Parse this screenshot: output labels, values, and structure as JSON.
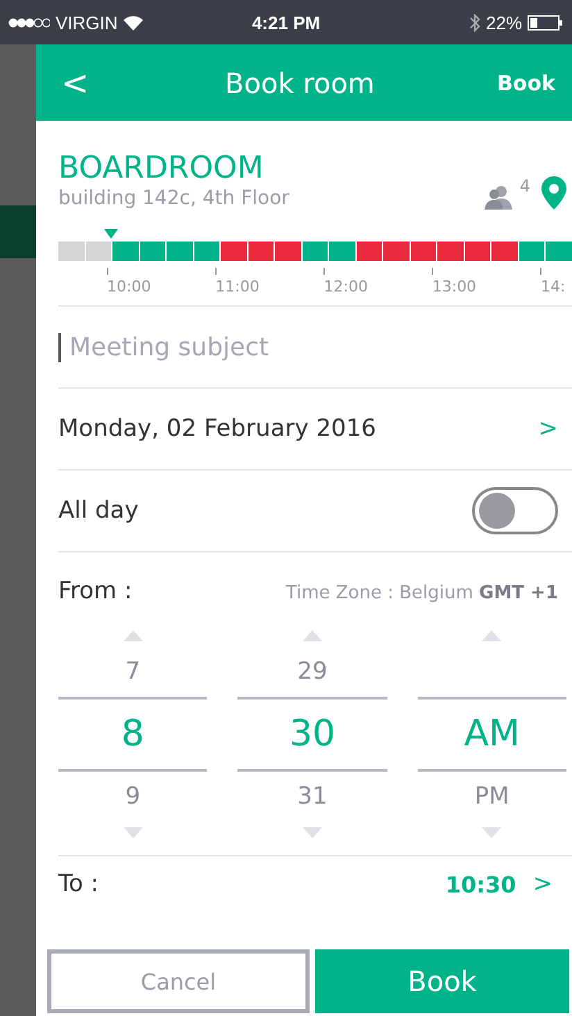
{
  "status_bar": {
    "carrier": "VIRGIN",
    "time": "4:21 PM",
    "battery": "22%"
  },
  "header": {
    "back": "<",
    "title": "Book room",
    "action": "Book"
  },
  "room": {
    "name": "BOARDROOM",
    "location": "building 142c, 4th Floor",
    "capacity": "4"
  },
  "timeline": {
    "slots": [
      {
        "kind": "past"
      },
      {
        "kind": "past"
      },
      {
        "kind": "free"
      },
      {
        "kind": "free"
      },
      {
        "kind": "free"
      },
      {
        "kind": "free"
      },
      {
        "kind": "busy"
      },
      {
        "kind": "busy"
      },
      {
        "kind": "busy"
      },
      {
        "kind": "free"
      },
      {
        "kind": "free"
      },
      {
        "kind": "busy"
      },
      {
        "kind": "busy"
      },
      {
        "kind": "busy"
      },
      {
        "kind": "busy"
      },
      {
        "kind": "busy"
      },
      {
        "kind": "busy"
      },
      {
        "kind": "free"
      },
      {
        "kind": "free"
      }
    ],
    "ticks": [
      "10:00",
      "11:00",
      "12:00",
      "13:00",
      "14:"
    ]
  },
  "subject": {
    "placeholder": "Meeting subject"
  },
  "date": {
    "value": "Monday, 02 February 2016",
    "chevron": ">"
  },
  "all_day": {
    "label": "All day",
    "on": false
  },
  "from": {
    "label": "From :",
    "timezone": "Time Zone : Belgium ",
    "timezone_offset": "GMT +1",
    "columns": [
      {
        "items": [
          {
            "text": "7",
            "selected": false
          },
          {
            "text": "8",
            "selected": true
          },
          {
            "text": "9",
            "selected": false
          }
        ]
      },
      {
        "items": [
          {
            "text": "29",
            "selected": false
          },
          {
            "text": "30",
            "selected": true
          },
          {
            "text": "31",
            "selected": false
          }
        ]
      },
      {
        "items": [
          {
            "text": "AM",
            "selected": true
          },
          {
            "text": "PM",
            "selected": false
          }
        ]
      }
    ]
  },
  "to": {
    "label": "To :",
    "value": "10:30",
    "chevron": ">"
  },
  "buttons": [
    {
      "kind": "secondary",
      "label": "Cancel"
    },
    {
      "kind": "primary",
      "label": "Book"
    }
  ]
}
